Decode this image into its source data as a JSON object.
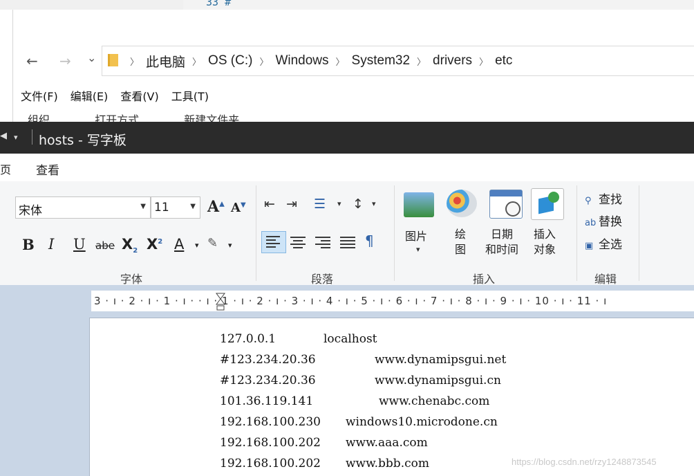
{
  "background_editor": {
    "line_number": "33 #"
  },
  "explorer": {
    "nav": {
      "back": "←",
      "forward": "→",
      "recent": "⌄",
      "up": "›"
    },
    "breadcrumb": [
      "此电脑",
      "OS (C:)",
      "Windows",
      "System32",
      "drivers",
      "etc"
    ],
    "menu": [
      "文件(F)",
      "编辑(E)",
      "查看(V)",
      "工具(T)"
    ],
    "commands_partial": [
      "组织",
      "打开方式",
      "新建文件夹"
    ]
  },
  "wordpad": {
    "title": "hosts - 写字板",
    "tab_cut": "页",
    "tab_view": "查看",
    "font": {
      "family": "宋体",
      "size": "11",
      "group_label": "字体"
    },
    "paragraph": {
      "group_label": "段落"
    },
    "insert": {
      "group_label": "插入",
      "picture": "图片",
      "paint": "绘\n图",
      "datetime": "日期\n和时间",
      "object": "插入\n对象"
    },
    "editing": {
      "group_label": "编辑",
      "find": "查找",
      "replace": "替换",
      "select_all": "全选"
    },
    "ruler_text": "3 · ı · 2 · ı · 1 · ı ·     · ı · 1 · ı · 2 · ı · 3 · ı · 4 · ı · 5 · ı · 6 · ı · 7 · ı · 8 · ı · 9 · ı · 10 · ı · 11 · ı",
    "document_lines": [
      {
        "ip": "127.0.0.1",
        "host": "localhost"
      },
      {
        "ip": "#123.234.20.36",
        "host": "www.dynamipsgui.net"
      },
      {
        "ip": "#123.234.20.36",
        "host": "www.dynamipsgui.cn"
      },
      {
        "ip": "101.36.119.141",
        "host": "www.chenabc.com"
      },
      {
        "ip": "192.168.100.230",
        "host": "windows10.microdone.cn"
      },
      {
        "ip": "192.168.100.202",
        "host": "www.aaa.com"
      },
      {
        "ip": "192.168.100.202",
        "host": "www.bbb.com"
      }
    ]
  },
  "watermark": "https://blog.csdn.net/rzy1248873545",
  "colors": {
    "titlebar": "#2b2b2b",
    "ribbon": "#f5f6f7",
    "workspace": "#c9d6e6",
    "accent": "#3264a8"
  }
}
